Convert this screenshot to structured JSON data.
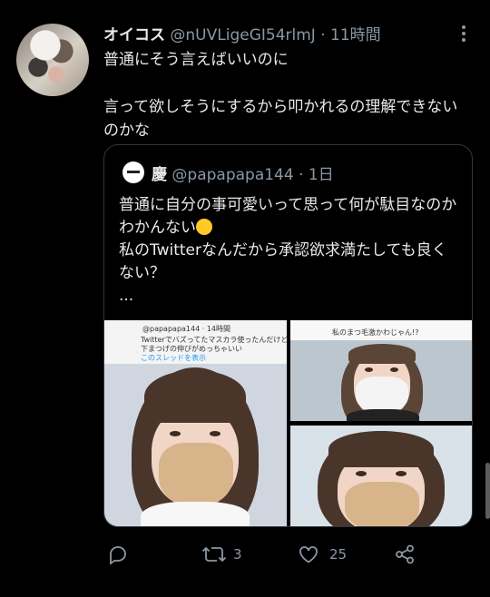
{
  "tweet": {
    "author_name": "オイコス",
    "author_handle": "@nUVLigeGI54rlmJ",
    "separator": "·",
    "time": "11時間",
    "text": "普通にそう言えばいいのに\n\n言って欲しそうにするから叩かれるの理解できないのかな"
  },
  "quote": {
    "author_name": "慶",
    "author_handle": "@papapapa144",
    "separator": "·",
    "time": "1日",
    "text": "普通に自分の事可愛いって思って何が駄目なのかわかんない",
    "text_after_emoji": "\n私のTwitterなんだから承認欲求満たしても良くない？\n...",
    "emoji": "drooling-face",
    "media": {
      "caption1": "@papapapa144 · 14時間",
      "caption2": "Twitterでバズってたマスカラ使ったんだけど",
      "caption3": "下まつげの伸びがめっちゃいい",
      "caption_link": "このスレッドを表示",
      "caption_top_right": "私のまつ毛激かわじゃん!?"
    }
  },
  "actions": {
    "reply_icon": "reply-icon",
    "retweet_icon": "retweet-icon",
    "retweet_count": "3",
    "like_icon": "like-icon",
    "like_count": "25",
    "share_icon": "share-icon"
  },
  "colors": {
    "background": "#000000",
    "text": "#e7e9ea",
    "secondary": "#8b98a5",
    "border": "#333639",
    "link": "#1d9bf0"
  }
}
